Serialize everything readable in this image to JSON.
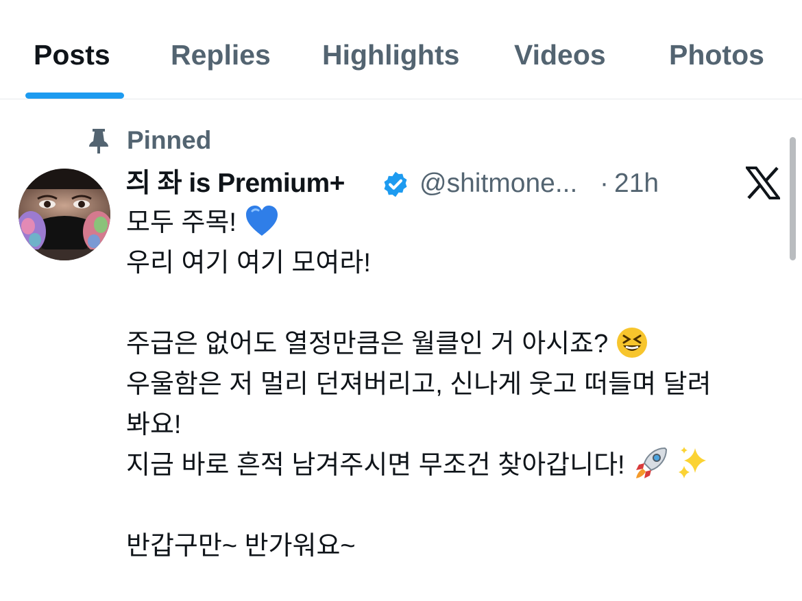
{
  "tabs": [
    {
      "label": "Posts",
      "active": true
    },
    {
      "label": "Replies",
      "active": false
    },
    {
      "label": "Highlights",
      "active": false
    },
    {
      "label": "Videos",
      "active": false
    },
    {
      "label": "Photos",
      "active": false
    }
  ],
  "pinned": {
    "label": "Pinned",
    "icon": "pin-icon"
  },
  "post": {
    "display_name": "즤 좌 is Premium+",
    "verified": true,
    "handle": "@shitmone...",
    "separator": "·",
    "time": "21h",
    "source_icon": "x-logo-icon",
    "lines": [
      "모두 주목! ",
      "우리 여기 여기 모여라!",
      "",
      "주급은 없어도 열정만큼은 월클인 거 아시죠? ",
      "우울함은 저 멀리 던져버리고, 신나게 웃고 떠들며 달려",
      "봐요!",
      "지금 바로 흔적 남겨주시면 무조건 찾아갑니다! ",
      "",
      "반갑구만~ 반가워요~"
    ],
    "emojis": {
      "line_0": "blue-heart-icon",
      "line_3": "grinning-squinting-face-icon",
      "line_6": [
        "rocket-icon",
        "sparkles-icon"
      ]
    }
  },
  "colors": {
    "accent": "#1d9bf0",
    "text_primary": "#0f1419",
    "text_secondary": "#536471",
    "verified": "#1d9bf0"
  }
}
